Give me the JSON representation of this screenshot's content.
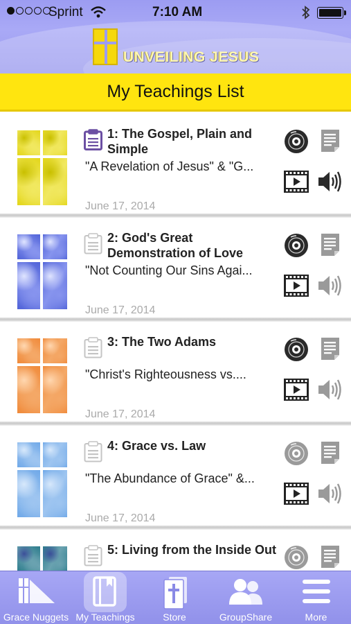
{
  "status_bar": {
    "carrier": "Sprint",
    "time": "7:10 AM"
  },
  "app": {
    "logo_text": "UNVEILING JESUS",
    "page_title": "My Teachings List"
  },
  "teachings": [
    {
      "title": "1: The Gospel, Plain and Simple",
      "subtitle": "\"A Revelation of Jesus\" & \"G...",
      "date": "June 17, 2014",
      "note_active": true,
      "audio_available": true,
      "disc_available": true,
      "thumb_color": "yellow"
    },
    {
      "title": "2: God's Great Demonstration of Love",
      "subtitle": "\"Not Counting Our Sins Agai...",
      "date": "June 17, 2014",
      "note_active": false,
      "audio_available": false,
      "disc_available": true,
      "thumb_color": "blue-white"
    },
    {
      "title": "3: The Two Adams",
      "subtitle": "\"Christ's Righteousness vs....",
      "date": "June 17, 2014",
      "note_active": false,
      "audio_available": false,
      "disc_available": true,
      "thumb_color": "orange"
    },
    {
      "title": "4: Grace vs. Law",
      "subtitle": "\"The Abundance of Grace\" &...",
      "date": "June 17, 2014",
      "note_active": false,
      "audio_available": false,
      "disc_available": false,
      "thumb_color": "light-blue"
    },
    {
      "title": "5: Living from the Inside Out",
      "subtitle": "",
      "date": "",
      "note_active": false,
      "audio_available": false,
      "disc_available": false,
      "thumb_color": "teal"
    }
  ],
  "tabs": [
    {
      "label": "Grace Nuggets",
      "icon": "grace-nuggets-icon",
      "active": false
    },
    {
      "label": "My Teachings",
      "icon": "book-icon",
      "active": true
    },
    {
      "label": "Store",
      "icon": "bible-stack-icon",
      "active": false
    },
    {
      "label": "GroupShare",
      "icon": "people-icon",
      "active": false
    },
    {
      "label": "More",
      "icon": "menu-icon",
      "active": false
    }
  ],
  "colors": {
    "header": "#9c9cf2",
    "title_band": "#ffe50f",
    "note_active": "#6b4fa3",
    "icon_dark": "#2a2a2a",
    "icon_muted": "#8e8e8e"
  }
}
